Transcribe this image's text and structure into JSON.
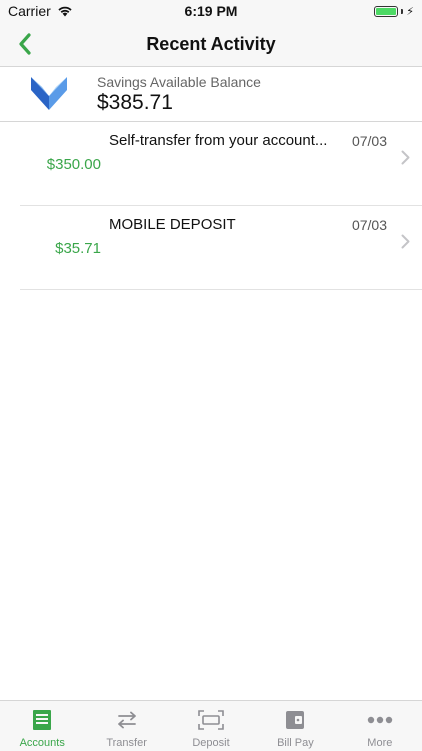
{
  "status_bar": {
    "carrier": "Carrier",
    "time": "6:19 PM",
    "battery_color": "#4cd964"
  },
  "nav": {
    "title": "Recent Activity",
    "back_icon": "chevron-left-icon",
    "accent": "#3aa64a"
  },
  "account": {
    "label": "Savings Available Balance",
    "balance": "$385.71"
  },
  "transactions": [
    {
      "description": "Self-transfer from your account...",
      "date": "07/03",
      "amount": "$350.00"
    },
    {
      "description": "MOBILE DEPOSIT",
      "date": "07/03",
      "amount": "$35.71"
    }
  ],
  "tabs": [
    {
      "label": "Accounts",
      "icon": "accounts-icon",
      "active": true
    },
    {
      "label": "Transfer",
      "icon": "transfer-icon",
      "active": false
    },
    {
      "label": "Deposit",
      "icon": "deposit-icon",
      "active": false
    },
    {
      "label": "Bill Pay",
      "icon": "wallet-icon",
      "active": false
    },
    {
      "label": "More",
      "icon": "more-icon",
      "active": false
    }
  ]
}
